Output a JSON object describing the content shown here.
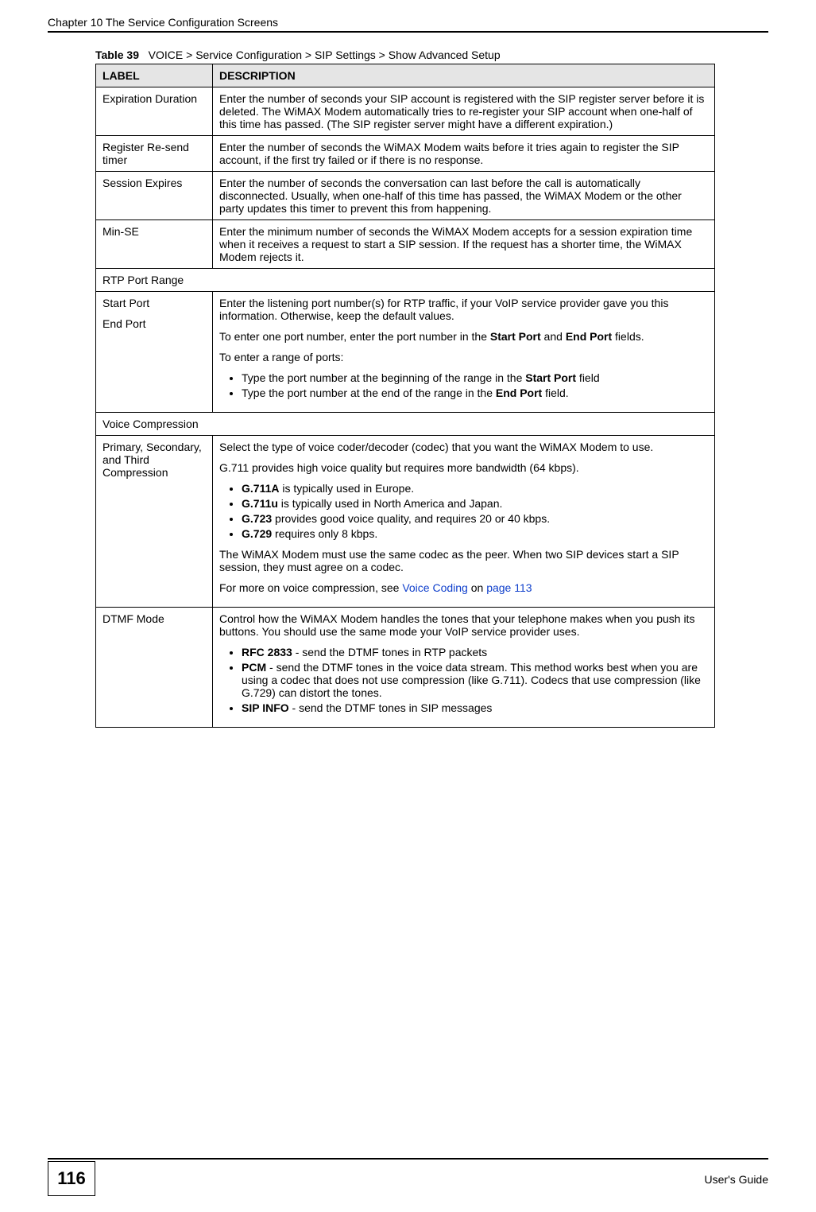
{
  "header": {
    "chapter": "Chapter 10 The Service Configuration Screens"
  },
  "table": {
    "caption_num": "Table 39",
    "caption_text": "VOICE > Service Configuration > SIP Settings > Show Advanced Setup",
    "col_label": "LABEL",
    "col_desc": "DESCRIPTION",
    "rows": {
      "expiration": {
        "label": "Expiration Duration",
        "desc": "Enter the number of seconds your SIP account is registered with the SIP register server before it is deleted. The WiMAX Modem automatically tries to re-register your SIP account when one-half of this time has passed. (The SIP register server might have a different expiration.)"
      },
      "register": {
        "label": "Register Re-send timer",
        "desc": "Enter the number of seconds the WiMAX Modem waits before it tries again to register the SIP account, if the first try failed or if there is no response."
      },
      "session": {
        "label": "Session Expires",
        "desc": "Enter the number of seconds the conversation can last before the call is automatically disconnected. Usually, when one-half of this time has passed, the WiMAX Modem or the other party updates this timer to prevent this from happening."
      },
      "minse": {
        "label": "Min-SE",
        "desc": "Enter the minimum number of seconds the WiMAX Modem accepts for a session expiration time when it receives a request to start a SIP session. If the request has a shorter time, the WiMAX Modem rejects it."
      },
      "rtpheader": "RTP Port Range",
      "ports": {
        "label1": "Start Port",
        "label2": "End Port",
        "p1": "Enter the listening port number(s) for RTP traffic, if your VoIP service provider gave you this information. Otherwise, keep the default values.",
        "p2a": "To enter one port number, enter the port number in the ",
        "p2b": "Start Port",
        "p2c": " and ",
        "p2d": "End Port",
        "p2e": " fields.",
        "p3": "To enter a range of ports:",
        "li1a": "Type the port number at the beginning of the range in the ",
        "li1b": "Start Port",
        "li1c": " field",
        "li2a": "Type the port number at the end of the range in the ",
        "li2b": "End Port",
        "li2c": " field."
      },
      "voiceheader": "Voice Compression",
      "compression": {
        "label": "Primary, Secondary, and Third Compression",
        "p1": "Select the type of voice coder/decoder (codec) that you want the WiMAX Modem to use.",
        "p2": "G.711 provides high voice quality but requires more bandwidth (64 kbps).",
        "li1a": "G.711A",
        "li1b": " is typically used in Europe.",
        "li2a": "G.711u",
        "li2b": " is typically used in North America and Japan.",
        "li3a": "G.723",
        "li3b": " provides good voice quality, and requires 20 or 40 kbps.",
        "li4a": "G.729",
        "li4b": " requires only 8 kbps.",
        "p3": "The WiMAX Modem must use the same codec as the peer. When two SIP devices start a SIP session, they must agree on a codec.",
        "p4a": "For more on voice compression, see ",
        "p4link1": "Voice Coding",
        "p4b": " on ",
        "p4link2": "page 113"
      },
      "dtmf": {
        "label": "DTMF Mode",
        "p1": "Control how the WiMAX Modem handles the tones that your telephone makes when you push its buttons. You should use the same mode your VoIP service provider uses.",
        "li1a": "RFC 2833",
        "li1b": " - send the DTMF tones in RTP packets",
        "li2a": "PCM",
        "li2b": " - send the DTMF tones in the voice data stream. This method works best when you are using a codec that does not use compression (like G.711). Codecs that use compression (like G.729) can distort the tones.",
        "li3a": "SIP INFO",
        "li3b": " - send the DTMF tones in SIP messages"
      }
    }
  },
  "footer": {
    "page": "116",
    "guide": "User's Guide"
  }
}
